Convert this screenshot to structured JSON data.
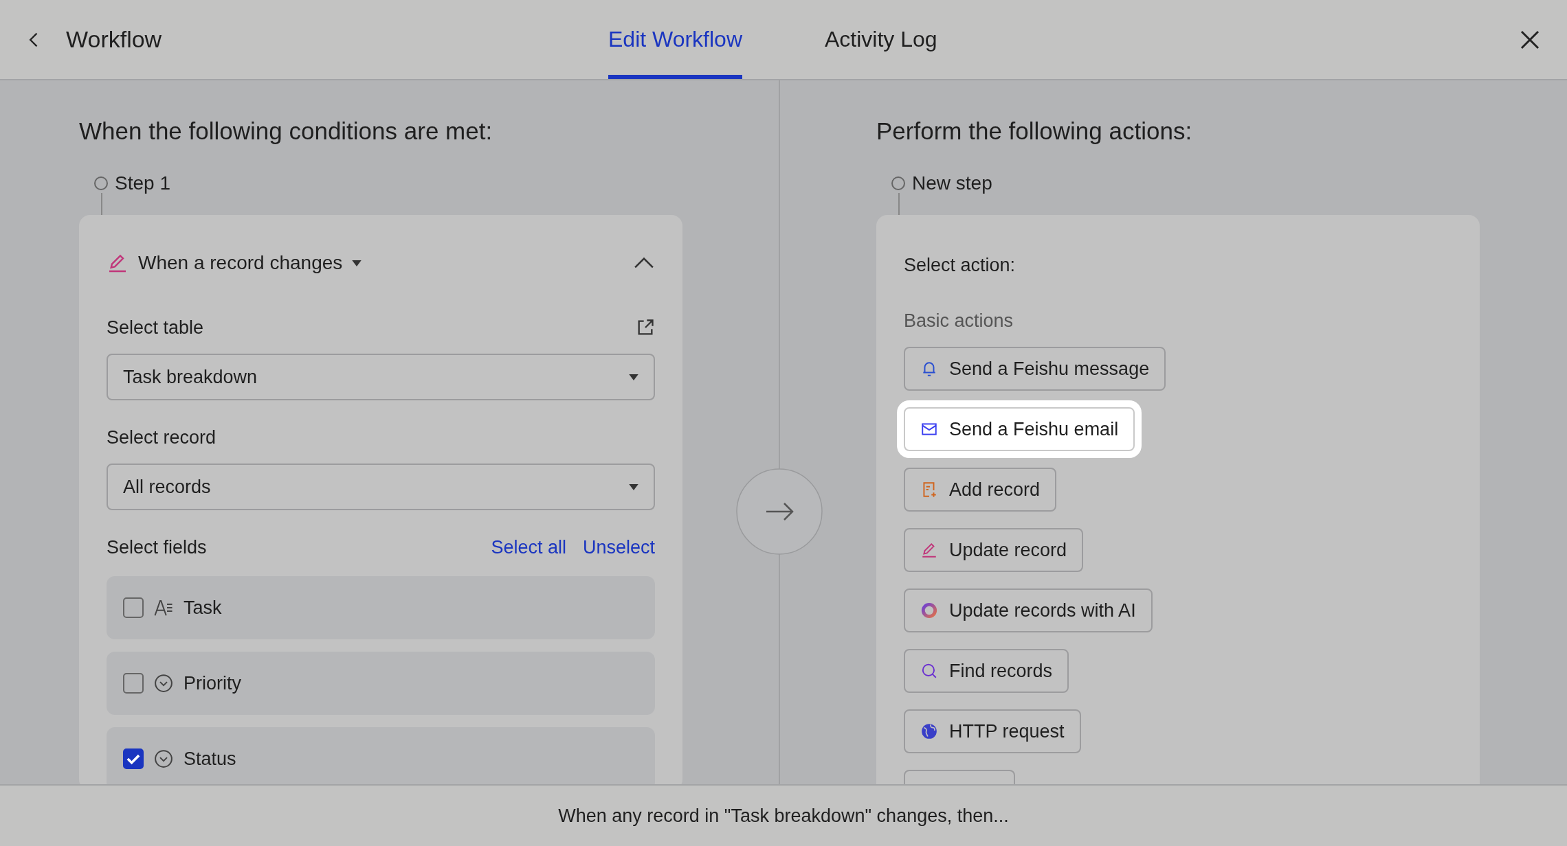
{
  "header": {
    "title": "Workflow",
    "tabs": [
      {
        "label": "Edit Workflow",
        "selected": true
      },
      {
        "label": "Activity Log",
        "selected": false
      }
    ]
  },
  "conditions": {
    "heading": "When the following conditions are met:",
    "step": "Step 1",
    "trigger": "When a record changes",
    "table_label": "Select table",
    "table_value": "Task breakdown",
    "record_label": "Select record",
    "record_value": "All records",
    "fields_label": "Select fields",
    "links": [
      "Select all",
      "Unselect"
    ],
    "fields": [
      {
        "name": "Task",
        "kind": "text",
        "checked": false
      },
      {
        "name": "Priority",
        "kind": "option",
        "checked": false
      },
      {
        "name": "Status",
        "kind": "option",
        "checked": true
      }
    ]
  },
  "actions": {
    "heading": "Perform the following actions:",
    "step": "New step",
    "select_label": "Select action:",
    "group_label": "Basic actions",
    "more_below": true,
    "items": [
      {
        "label": "Send a Feishu message",
        "kind": "message",
        "highlighted": false
      },
      {
        "label": "Send a Feishu email",
        "kind": "email",
        "highlighted": true
      },
      {
        "label": "Add record",
        "kind": "add",
        "highlighted": false
      },
      {
        "label": "Update record",
        "kind": "update",
        "highlighted": false
      },
      {
        "label": "Update records with AI",
        "kind": "ai",
        "highlighted": false
      },
      {
        "label": "Find records",
        "kind": "find",
        "highlighted": false
      },
      {
        "label": "HTTP request",
        "kind": "http",
        "highlighted": false
      }
    ]
  },
  "footer": {
    "text": "When any record in \"Task breakdown\" changes, then..."
  }
}
